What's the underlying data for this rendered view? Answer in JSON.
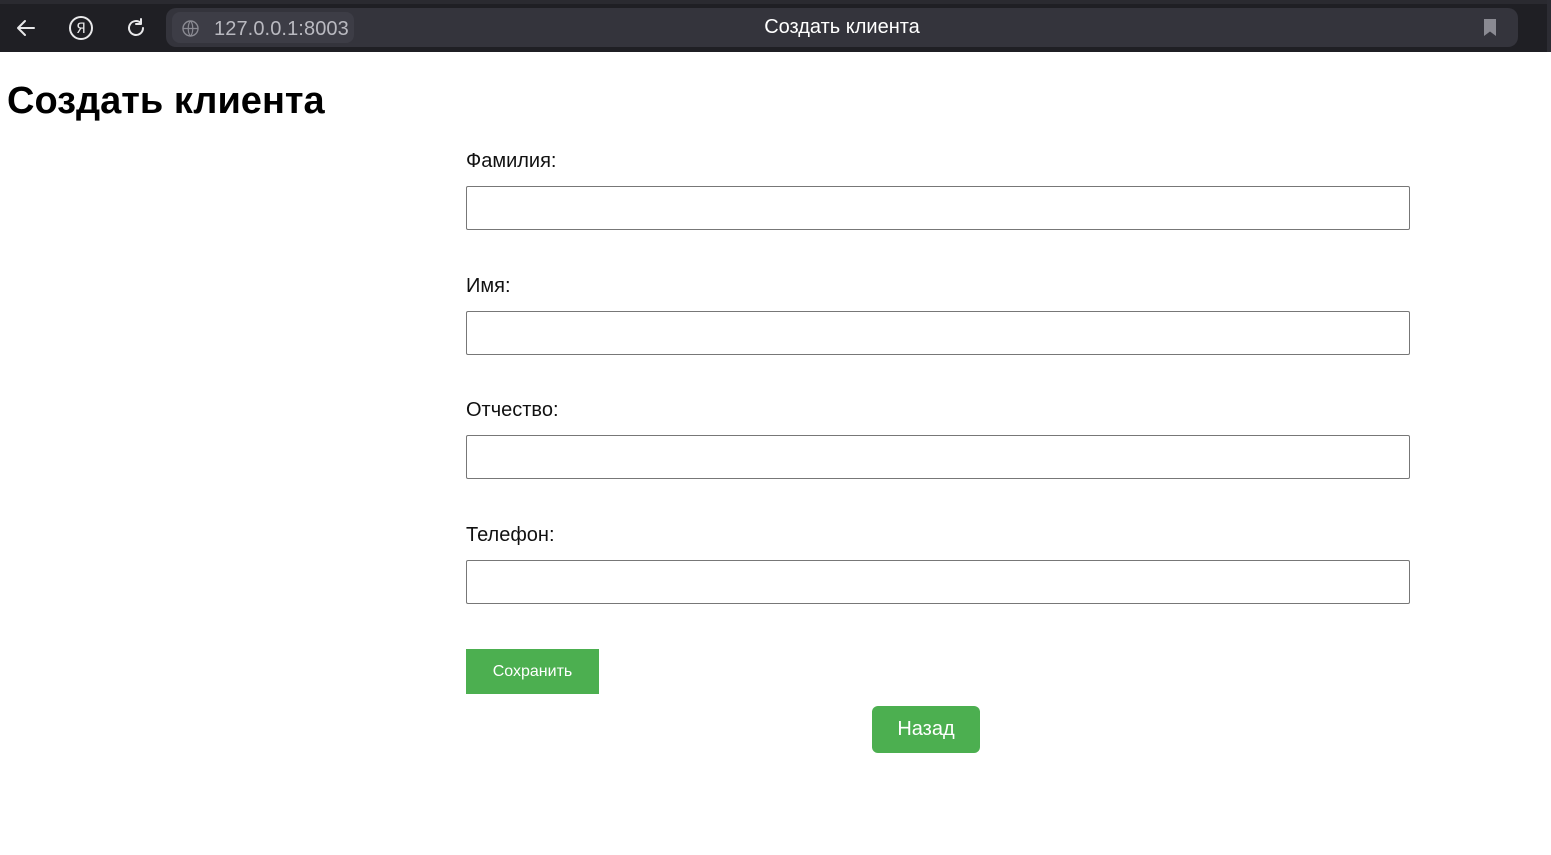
{
  "browser": {
    "url": "127.0.0.1:8003",
    "tab_title": "Создать клиента",
    "icons": [
      "back-arrow-icon",
      "yandex-icon",
      "reload-icon",
      "globe-icon",
      "bookmark-icon"
    ]
  },
  "page": {
    "title": "Создать клиента"
  },
  "form": {
    "fields": [
      {
        "label": "Фамилия:",
        "value": ""
      },
      {
        "label": "Имя:",
        "value": ""
      },
      {
        "label": "Отчество:",
        "value": ""
      },
      {
        "label": "Телефон:",
        "value": ""
      }
    ],
    "save_label": "Сохранить"
  },
  "back_label": "Назад",
  "colors": {
    "button": "#4caf50",
    "browser_bar": "#1f1f24"
  }
}
